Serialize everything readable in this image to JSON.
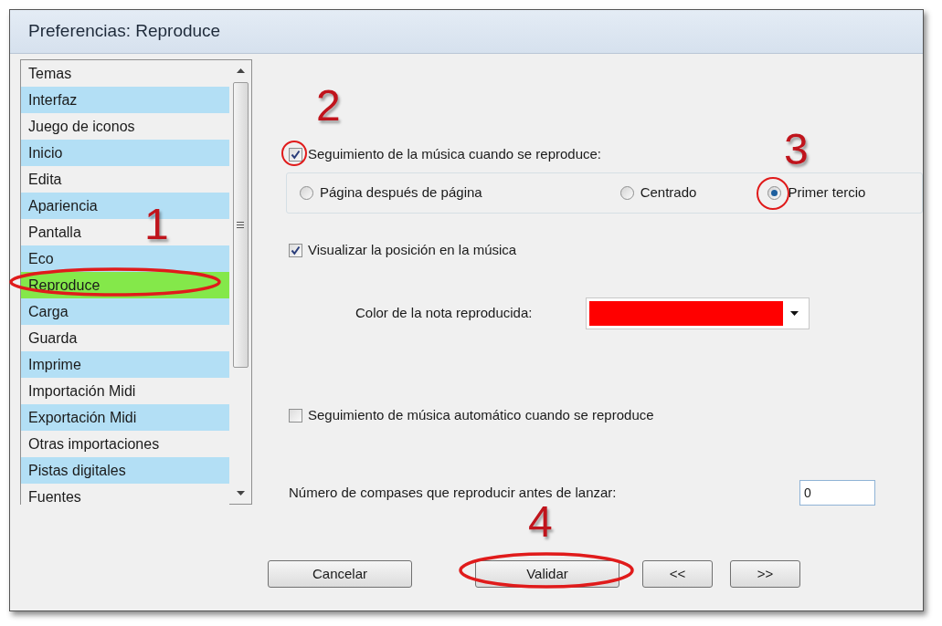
{
  "window": {
    "title": "Preferencias: Reproduce"
  },
  "sidebar": {
    "items": [
      {
        "label": "Temas",
        "selected": false
      },
      {
        "label": "Interfaz",
        "selected": false
      },
      {
        "label": "Juego de iconos",
        "selected": false
      },
      {
        "label": "Inicio",
        "selected": false
      },
      {
        "label": "Edita",
        "selected": false
      },
      {
        "label": "Apariencia",
        "selected": false
      },
      {
        "label": "Pantalla",
        "selected": false
      },
      {
        "label": "Eco",
        "selected": false
      },
      {
        "label": "Reproduce",
        "selected": true
      },
      {
        "label": "Carga",
        "selected": false
      },
      {
        "label": "Guarda",
        "selected": false
      },
      {
        "label": "Imprime",
        "selected": false
      },
      {
        "label": "Importación Midi",
        "selected": false
      },
      {
        "label": "Exportación Midi",
        "selected": false
      },
      {
        "label": "Otras importaciones",
        "selected": false
      },
      {
        "label": "Pistas digitales",
        "selected": false
      },
      {
        "label": "Fuentes",
        "selected": false
      }
    ]
  },
  "follow_music": {
    "label": "Seguimiento de la música cuando se reproduce:",
    "checked": true
  },
  "follow_mode": [
    {
      "label": "Página después de página",
      "selected": false
    },
    {
      "label": "Centrado",
      "selected": false
    },
    {
      "label": "Primer tercio",
      "selected": true
    }
  ],
  "show_position": {
    "label": "Visualizar la posición en la música",
    "checked": true
  },
  "note_color": {
    "label": "Color de la nota reproducida:",
    "color": "#ff0000"
  },
  "auto_follow": {
    "label": "Seguimiento de música automático cuando se reproduce",
    "checked": false
  },
  "count_in": {
    "label": "Número de compases que reproducir antes de lanzar:",
    "value": "0"
  },
  "buttons": [
    {
      "label": "Cancelar"
    },
    {
      "label": "Validar"
    },
    {
      "label": "<<"
    },
    {
      "label": ">>"
    }
  ],
  "annotations": [
    {
      "label": "1"
    },
    {
      "label": "2"
    },
    {
      "label": "3"
    },
    {
      "label": "4"
    }
  ]
}
